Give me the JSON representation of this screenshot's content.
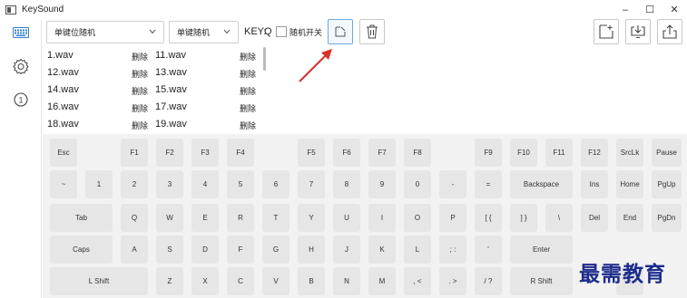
{
  "window": {
    "title": "KeySound",
    "minimize": "–",
    "maximize": "☐",
    "close": "✕"
  },
  "nav": {
    "items": [
      "keyboard-icon",
      "settings-icon",
      "info-icon"
    ]
  },
  "toolbar": {
    "mode_dropdown": "单键位随机",
    "random_dropdown": "单键随机",
    "key_label": "KEY:",
    "key_value": "Q",
    "random_switch_label": "随机开关",
    "random_switch_checked": false,
    "accent_color": "#6aa7e6"
  },
  "files": {
    "rows": [
      {
        "left": "1.wav",
        "left_delete": "删除",
        "right": "11.wav",
        "right_delete": "删除"
      },
      {
        "left": "12.wav",
        "left_delete": "删除",
        "right": "13.wav",
        "right_delete": "删除"
      },
      {
        "left": "14.wav",
        "left_delete": "删除",
        "right": "15.wav",
        "right_delete": "删除"
      },
      {
        "left": "16.wav",
        "left_delete": "删除",
        "right": "17.wav",
        "right_delete": "删除"
      },
      {
        "left": "18.wav",
        "left_delete": "删除",
        "right": "19.wav",
        "right_delete": "删除"
      }
    ]
  },
  "keyboard": {
    "row1": [
      "Esc",
      "F1",
      "F2",
      "F3",
      "F4",
      "F5",
      "F6",
      "F7",
      "F8",
      "F9",
      "F10",
      "F11",
      "F12",
      "SrcLk",
      "Pause"
    ],
    "row2": [
      "~",
      "1",
      "2",
      "3",
      "4",
      "5",
      "6",
      "7",
      "8",
      "9",
      "0",
      "-",
      "=",
      "Backspace",
      "Ins",
      "Home",
      "PgUp"
    ],
    "row3": [
      "Tab",
      "Q",
      "W",
      "E",
      "R",
      "T",
      "Y",
      "U",
      "I",
      "O",
      "P",
      "[ {",
      "] }",
      "\\",
      "Del",
      "End",
      "PgDn"
    ],
    "row4": [
      "Caps",
      "A",
      "S",
      "D",
      "F",
      "G",
      "H",
      "J",
      "K",
      "L",
      "; :",
      "'",
      "Enter"
    ],
    "row5": [
      "L Shift",
      "Z",
      "X",
      "C",
      "V",
      "B",
      "N",
      "M",
      ", <",
      ". >",
      "/ ?",
      "R Shift",
      "↑"
    ]
  },
  "watermark": {
    "text": "最需教育"
  }
}
